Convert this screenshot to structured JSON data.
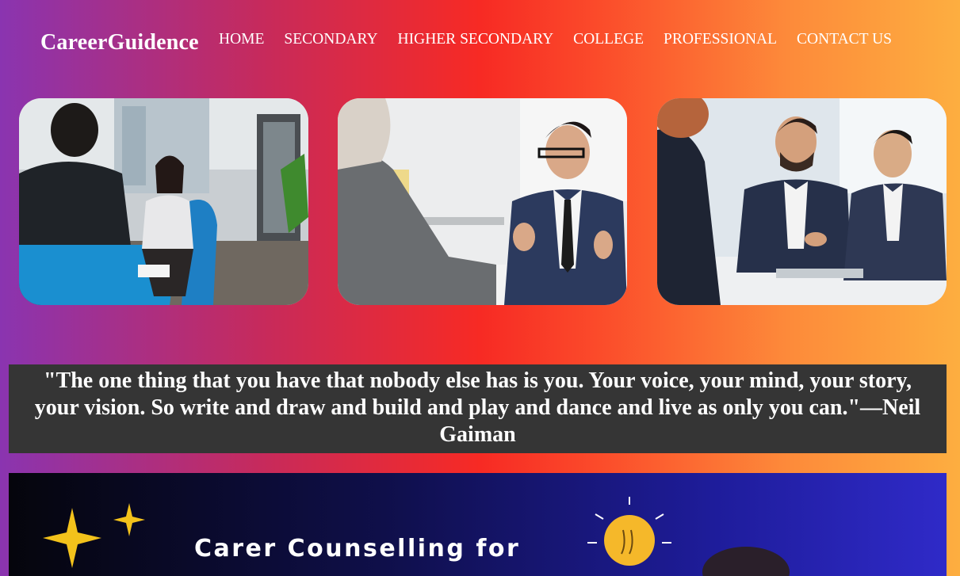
{
  "header": {
    "brand": "CareerGuidence",
    "nav": [
      "HOME",
      "SECONDARY",
      "HIGHER SECONDARY",
      "COLLEGE",
      "PROFESSIONAL",
      "CONTACT US"
    ]
  },
  "gallery": {
    "images": [
      {
        "name": "counselling-session-photo"
      },
      {
        "name": "interview-photo"
      },
      {
        "name": "business-meeting-photo"
      }
    ]
  },
  "quote": {
    "text": "\"The one thing that you have that nobody else has is you. Your voice, your mind, your story, your vision. So write and draw and build and play and dance and live as only you can.\"—Neil Gaiman"
  },
  "banner": {
    "title": "Carer Counselling for"
  }
}
